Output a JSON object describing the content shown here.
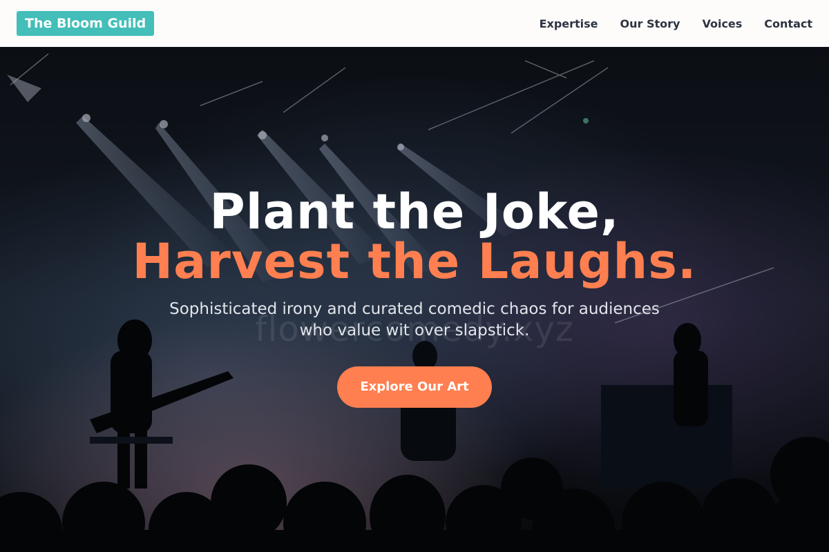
{
  "header": {
    "logo": "The Bloom Guild",
    "nav": [
      "Expertise",
      "Our Story",
      "Voices",
      "Contact"
    ]
  },
  "hero": {
    "headline_line1": "Plant the Joke,",
    "headline_line2": "Harvest the Laughs.",
    "subtitle": "Sophisticated irony and curated comedic chaos for audiences who value wit over slapstick.",
    "cta": "Explore Our Art",
    "watermark": "flowercomedy.xyz"
  },
  "colors": {
    "brand": "#43beb8",
    "accent": "#ff7f50",
    "nav_text": "#2d3340"
  }
}
